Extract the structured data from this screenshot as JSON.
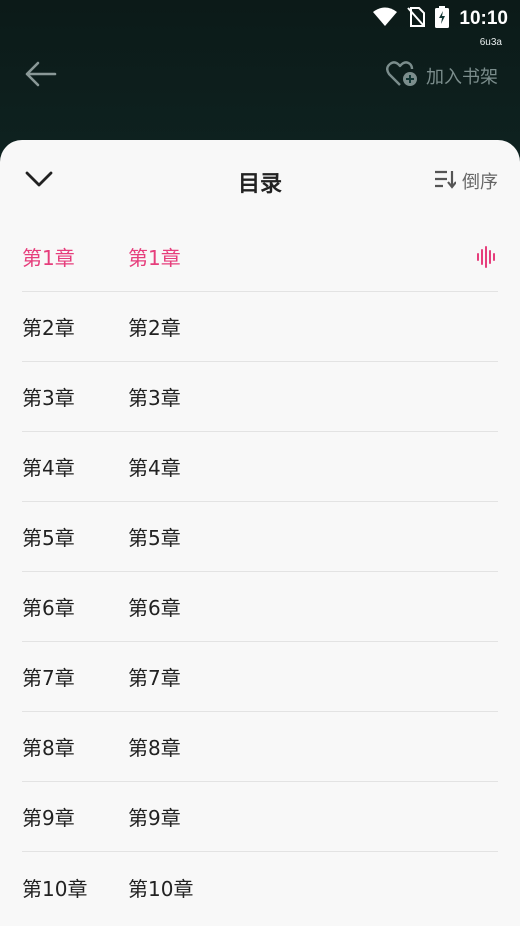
{
  "status_bar": {
    "time": "10:10",
    "sub_label": "6u3a",
    "icons": [
      "wifi-icon",
      "no-signal-icon",
      "battery-charging-icon"
    ]
  },
  "topbar": {
    "back_icon": "arrow-left-icon",
    "shelf_label": "加入书架",
    "shelf_icon": "heart-plus-icon"
  },
  "sheet": {
    "title": "目录",
    "sort_label": "倒序",
    "collapse_icon": "chevron-down-icon",
    "sort_icon": "sort-descending-icon"
  },
  "chapters": [
    {
      "num": "第1章",
      "title": "第1章",
      "active": true
    },
    {
      "num": "第2章",
      "title": "第2章"
    },
    {
      "num": "第3章",
      "title": "第3章"
    },
    {
      "num": "第4章",
      "title": "第4章"
    },
    {
      "num": "第5章",
      "title": "第5章"
    },
    {
      "num": "第6章",
      "title": "第6章"
    },
    {
      "num": "第7章",
      "title": "第7章"
    },
    {
      "num": "第8章",
      "title": "第8章"
    },
    {
      "num": "第9章",
      "title": "第9章"
    },
    {
      "num": "第10章",
      "title": "第10章"
    }
  ],
  "colors": {
    "accent": "#e63e7c",
    "sheet_bg": "#f8f8f8",
    "header_bg": "#123634"
  }
}
